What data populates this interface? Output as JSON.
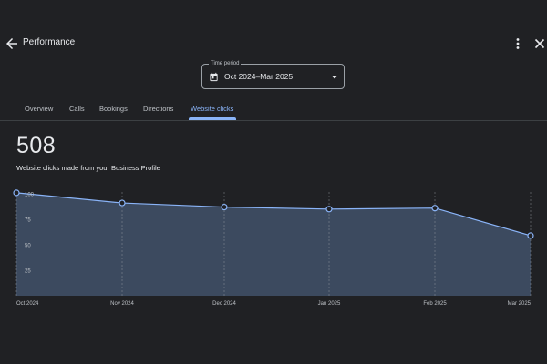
{
  "header": {
    "title": "Performance",
    "back_icon": "arrow-back-icon",
    "menu_icon": "more-vert-icon",
    "close_icon": "close-icon"
  },
  "time_period": {
    "label": "Time period",
    "value": "Oct 2024–Mar 2025",
    "icon": "calendar-icon"
  },
  "tabs": [
    {
      "label": "Overview",
      "active": false
    },
    {
      "label": "Calls",
      "active": false
    },
    {
      "label": "Bookings",
      "active": false
    },
    {
      "label": "Directions",
      "active": false
    },
    {
      "label": "Website clicks",
      "active": true
    }
  ],
  "metric": {
    "value": "508",
    "description": "Website clicks made from your Business Profile"
  },
  "colors": {
    "background": "#202124",
    "accent": "#8ab4f8",
    "area_fill": "#3c4a5f",
    "line": "#8ab4f8"
  },
  "chart_data": {
    "type": "area",
    "x": [
      "Oct 2024",
      "Nov 2024",
      "Dec 2024",
      "Jan 2025",
      "Feb 2025",
      "Mar 2025"
    ],
    "series": [
      {
        "values": [
          101,
          91,
          87,
          85,
          86,
          59
        ]
      }
    ],
    "y_ticks": [
      "100",
      "75",
      "50",
      "25"
    ],
    "ylim": [
      0,
      100
    ],
    "grid": "vertical-dashed"
  }
}
